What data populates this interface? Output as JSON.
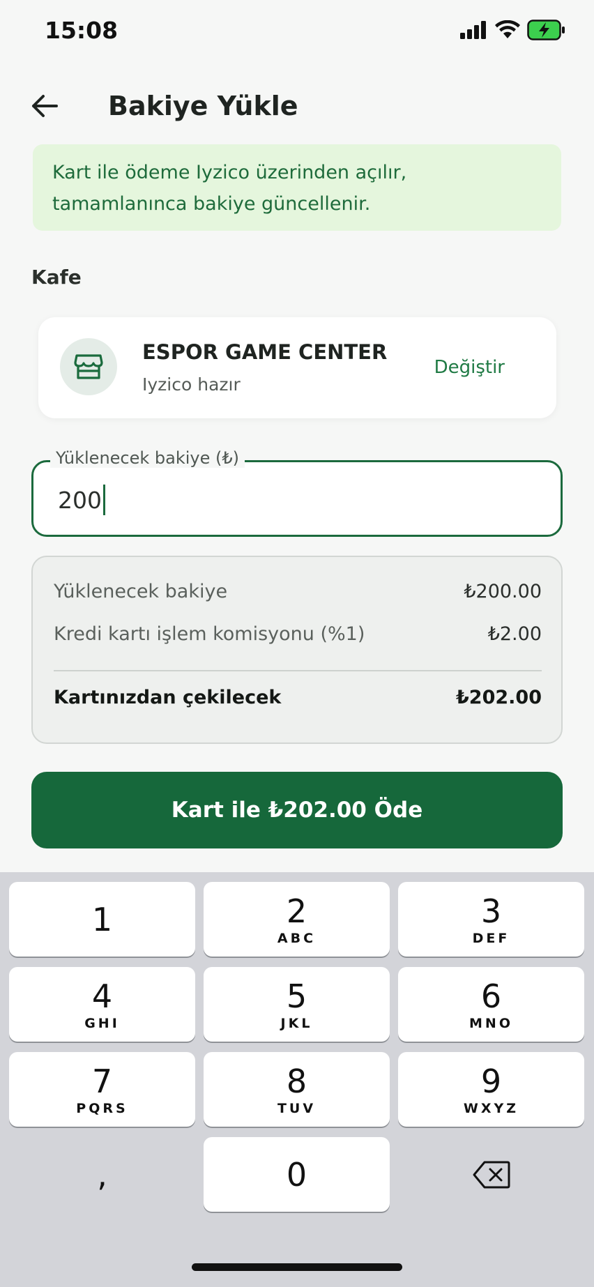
{
  "status_bar": {
    "time": "15:08"
  },
  "header": {
    "title": "Bakiye Yükle"
  },
  "info_banner": {
    "line1": "Kart ile ödeme Iyzico üzerinden açılır,",
    "line2": "tamamlanınca bakiye güncellenir."
  },
  "cafe_section": {
    "label": "Kafe",
    "name": "ESPOR GAME CENTER",
    "status": "Iyzico hazır",
    "change_label": "Değiştir"
  },
  "amount_field": {
    "label": "Yüklenecek bakiye (₺)",
    "value": "200"
  },
  "summary": {
    "rows": [
      {
        "label": "Yüklenecek bakiye",
        "value": "₺200.00"
      },
      {
        "label": "Kredi kartı işlem komisyonu (%1)",
        "value": "₺2.00"
      }
    ],
    "total": {
      "label": "Kartınızdan çekilecek",
      "value": "₺202.00"
    }
  },
  "pay_button": {
    "label": "Kart ile ₺202.00 Öde"
  },
  "keypad": {
    "keys": [
      {
        "digit": "1",
        "letters": ""
      },
      {
        "digit": "2",
        "letters": "ABC"
      },
      {
        "digit": "3",
        "letters": "DEF"
      },
      {
        "digit": "4",
        "letters": "GHI"
      },
      {
        "digit": "5",
        "letters": "JKL"
      },
      {
        "digit": "6",
        "letters": "MNO"
      },
      {
        "digit": "7",
        "letters": "PQRS"
      },
      {
        "digit": "8",
        "letters": "TUV"
      },
      {
        "digit": "9",
        "letters": "WXYZ"
      },
      {
        "digit": ",",
        "letters": ""
      },
      {
        "digit": "0",
        "letters": ""
      }
    ]
  },
  "colors": {
    "accent": "#16683b",
    "banner_bg": "#e5f6dd",
    "banner_text": "#1e6b3b",
    "keypad_bg": "#d3d4d9"
  }
}
